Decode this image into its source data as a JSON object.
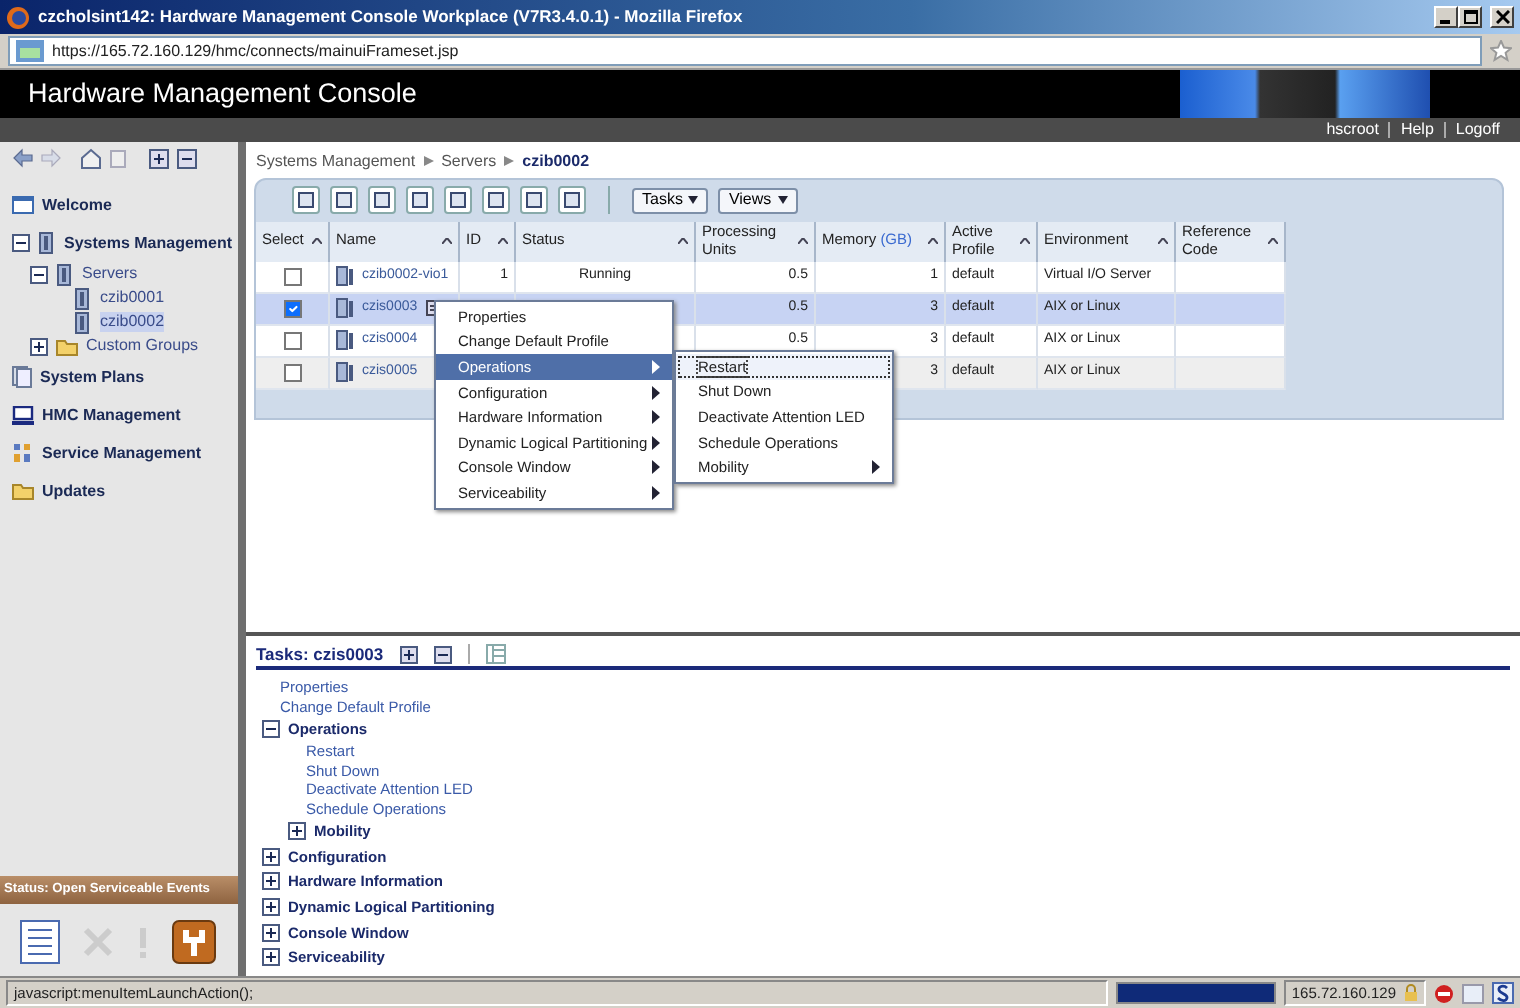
{
  "window": {
    "title": "czcholsint142: Hardware Management Console Workplace (V7R3.4.0.1) - Mozilla Firefox"
  },
  "browser": {
    "url": "https://165.72.160.129/hmc/connects/mainuiFrameset.jsp"
  },
  "header": {
    "title": "Hardware Management Console",
    "user_links": [
      "hscroot",
      "Help",
      "Logoff"
    ]
  },
  "nav": {
    "items": [
      {
        "label": "Welcome"
      },
      {
        "label": "Systems Management",
        "expanded": true,
        "children": [
          {
            "label": "Servers",
            "expanded": true,
            "children": [
              {
                "label": "czib0001",
                "selected": false
              },
              {
                "label": "czib0002",
                "selected": true
              }
            ]
          },
          {
            "label": "Custom Groups",
            "expanded": false
          }
        ]
      },
      {
        "label": "System Plans"
      },
      {
        "label": "HMC Management"
      },
      {
        "label": "Service Management"
      },
      {
        "label": "Updates"
      }
    ]
  },
  "status_panel": {
    "label": "Status: Open Serviceable Events"
  },
  "breadcrumb": [
    "Systems Management",
    "Servers",
    "czib0002"
  ],
  "table": {
    "menus": [
      "Tasks",
      "Views"
    ],
    "columns": [
      {
        "label": "Select"
      },
      {
        "label": "Name"
      },
      {
        "label": "ID"
      },
      {
        "label": "Status"
      },
      {
        "label": "Processing Units"
      },
      {
        "label": "Memory",
        "unit": "(GB)"
      },
      {
        "label": "Active Profile"
      },
      {
        "label": "Environment"
      },
      {
        "label": "Reference Code"
      }
    ],
    "rows": [
      {
        "selected": false,
        "highlighted": false,
        "name": "czib0002-vio1",
        "id": "1",
        "status": "Running",
        "processing_units": "0.5",
        "memory": "1",
        "profile": "default",
        "environment": "Virtual I/O Server"
      },
      {
        "selected": true,
        "highlighted": false,
        "name": "czis0003",
        "id": null,
        "status": null,
        "processing_units": "0.5",
        "memory": "3",
        "profile": "default",
        "environment": "AIX or Linux"
      },
      {
        "selected": false,
        "highlighted": false,
        "name": "czis0004",
        "id": null,
        "status": null,
        "processing_units": "0.5",
        "memory": "3",
        "profile": "default",
        "environment": "AIX or Linux"
      },
      {
        "selected": false,
        "highlighted": true,
        "name": "czis0005",
        "id": null,
        "status": null,
        "processing_units": null,
        "memory": "3",
        "profile": "default",
        "environment": "AIX or Linux"
      }
    ]
  },
  "context_menu": {
    "items": [
      {
        "label": "Properties",
        "submenu": false,
        "selected": false
      },
      {
        "label": "Change Default Profile",
        "submenu": false,
        "selected": false
      },
      {
        "label": "Operations",
        "submenu": true,
        "selected": true
      },
      {
        "label": "Configuration",
        "submenu": true,
        "selected": false
      },
      {
        "label": "Hardware Information",
        "submenu": true,
        "selected": false
      },
      {
        "label": "Dynamic Logical Partitioning",
        "submenu": true,
        "selected": false
      },
      {
        "label": "Console Window",
        "submenu": true,
        "selected": false
      },
      {
        "label": "Serviceability",
        "submenu": true,
        "selected": false
      }
    ],
    "submenu": [
      {
        "label": "Restart",
        "submenu": false,
        "selected": true
      },
      {
        "label": "Shut Down",
        "submenu": false,
        "selected": false
      },
      {
        "label": "Deactivate Attention LED",
        "submenu": false,
        "selected": false
      },
      {
        "label": "Schedule Operations",
        "submenu": false,
        "selected": false
      },
      {
        "label": "Mobility",
        "submenu": true,
        "selected": false
      }
    ]
  },
  "tasks": {
    "title": "Tasks: czis0003",
    "items": [
      {
        "label": "Properties",
        "kind": "link"
      },
      {
        "label": "Change Default Profile",
        "kind": "link"
      },
      {
        "label": "Operations",
        "kind": "group",
        "expanded": true,
        "children": [
          {
            "label": "Restart",
            "kind": "link"
          },
          {
            "label": "Shut Down",
            "kind": "link"
          },
          {
            "label": "Deactivate Attention LED",
            "kind": "link"
          },
          {
            "label": "Schedule Operations",
            "kind": "link"
          },
          {
            "label": "Mobility",
            "kind": "group",
            "expanded": false
          }
        ]
      },
      {
        "label": "Configuration",
        "kind": "group",
        "expanded": false
      },
      {
        "label": "Hardware Information",
        "kind": "group",
        "expanded": false
      },
      {
        "label": "Dynamic Logical Partitioning",
        "kind": "group",
        "expanded": false
      },
      {
        "label": "Console Window",
        "kind": "group",
        "expanded": false
      },
      {
        "label": "Serviceability",
        "kind": "group",
        "expanded": false
      }
    ]
  },
  "status_bar": {
    "text": "javascript:menuItemLaunchAction();",
    "level": 1,
    "host": "165.72.160.129"
  }
}
